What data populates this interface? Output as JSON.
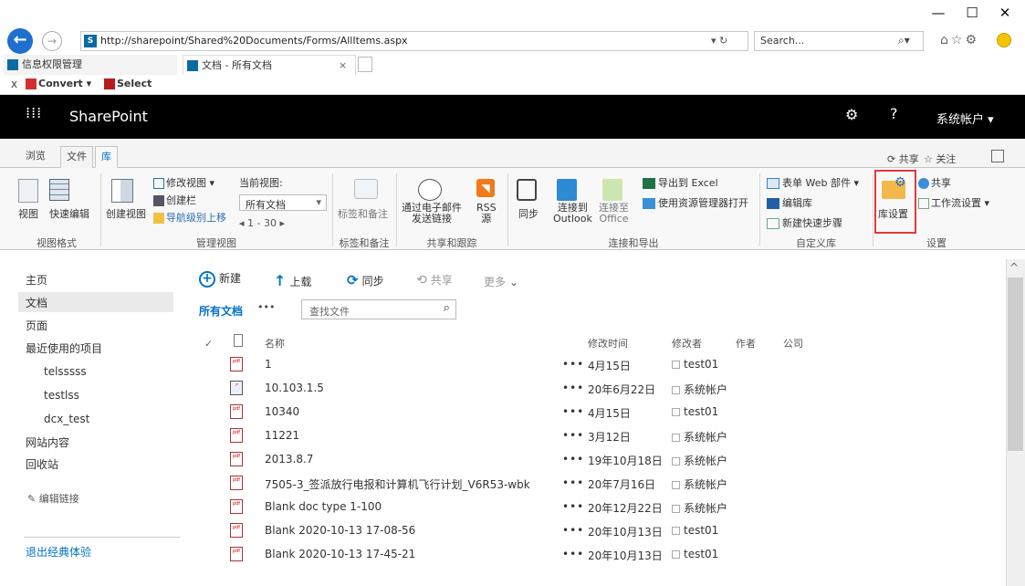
{
  "browser": {
    "address": "http://sharepoint/Shared%20Documents/Forms/AllItems.aspx",
    "address_controls": "▾ ↻",
    "search_placeholder": "Search...",
    "tabs": [
      {
        "label": "信息权限管理"
      },
      {
        "label": "文档 - 所有文档"
      }
    ],
    "fav": {
      "close": "x",
      "convert": "Convert",
      "select": "Select"
    }
  },
  "suite": {
    "brand": "SharePoint",
    "user": "系统帐户",
    "help": "?"
  },
  "ribbon": {
    "tabs": [
      "浏览",
      "文件",
      "库"
    ],
    "active_tab": "库",
    "right_actions": {
      "share": "共享",
      "follow": "关注"
    },
    "groups": [
      {
        "label": "视图格式"
      },
      {
        "label": "管理视图"
      },
      {
        "label": "标签和备注"
      },
      {
        "label": "共享和跟踪"
      },
      {
        "label": "连接和导出"
      },
      {
        "label": "自定义库"
      },
      {
        "label": "设置"
      }
    ],
    "buttons": {
      "view": "视图",
      "quick_edit": "快速编辑",
      "create_view": "创建视图",
      "modify_view": "修改视图",
      "create_column": "创建栏",
      "navigate_up": "导航级别上移",
      "current_view_label": "当前视图:",
      "current_view_value": "所有文档",
      "pager": "1 - 30",
      "tags_notes": "标签和备注",
      "email_link_1": "通过电子邮件",
      "email_link_2": "发送链接",
      "rss_1": "RSS",
      "rss_2": "源",
      "sync": "同步",
      "connect_outlook_1": "连接到",
      "connect_outlook_2": "Outlook",
      "connect_office_1": "连接至",
      "connect_office_2": "Office",
      "export_excel": "导出到 Excel",
      "open_explorer": "使用资源管理器打开",
      "form_web_parts": "表单 Web 部件",
      "edit_library": "编辑库",
      "new_quick_step": "新建快速步骤",
      "library_settings": "库设置",
      "share": "共享",
      "workflow_settings": "工作流设置"
    }
  },
  "leftnav": {
    "items": [
      {
        "label": "主页"
      },
      {
        "label": "文档"
      },
      {
        "label": "页面"
      },
      {
        "label": "最近使用的项目"
      },
      {
        "label": "telsssss"
      },
      {
        "label": "testlss"
      },
      {
        "label": "dcx_test"
      },
      {
        "label": "网站内容"
      },
      {
        "label": "回收站"
      }
    ],
    "edit_links": "编辑链接",
    "exit_classic": "退出经典体验"
  },
  "commands": {
    "new": "新建",
    "upload": "上载",
    "sync": "同步",
    "share": "共享",
    "more": "更多"
  },
  "view": {
    "current": "所有文档",
    "dots": "•••",
    "search_placeholder": "查找文件"
  },
  "columns": {
    "name": "名称",
    "modified": "修改时间",
    "modified_by": "修改者",
    "author": "作者",
    "company": "公司"
  },
  "rows": [
    {
      "name": "1",
      "modified": "4月15日",
      "editor": "test01",
      "icon": "pdf-icon"
    },
    {
      "name": "10.103.1.5",
      "modified": "20年6月22日",
      "editor": "系统帐户",
      "icon": "link-file-icon"
    },
    {
      "name": "10340",
      "modified": "4月15日",
      "editor": "test01",
      "icon": "pdf-icon"
    },
    {
      "name": "11221",
      "modified": "3月12日",
      "editor": "系统帐户",
      "icon": "pdf-icon"
    },
    {
      "name": "2013.8.7",
      "modified": "19年10月18日",
      "editor": "系统帐户",
      "icon": "pdf-icon"
    },
    {
      "name": "7505-3_签派放行电报和计算机飞行计划_V6R53-wbk",
      "modified": "20年7月16日",
      "editor": "系统帐户",
      "icon": "pdf-icon"
    },
    {
      "name": "Blank doc type 1-100",
      "modified": "20年12月22日",
      "editor": "系统帐户",
      "icon": "pdf-icon"
    },
    {
      "name": "Blank 2020-10-13 17-08-56",
      "modified": "20年10月13日",
      "editor": "test01",
      "icon": "pdf-icon"
    },
    {
      "name": "Blank 2020-10-13 17-45-21",
      "modified": "20年10月13日",
      "editor": "test01",
      "icon": "pdf-icon"
    }
  ],
  "colors": {
    "accent": "#0072c6",
    "highlight": "#e0393e",
    "suite": "#000000"
  }
}
